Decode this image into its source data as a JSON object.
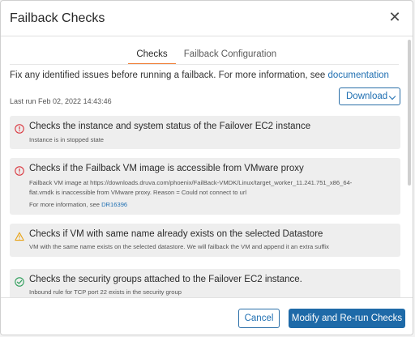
{
  "dialog": {
    "title": "Failback Checks"
  },
  "tabs": [
    {
      "label": "Checks",
      "active": true
    },
    {
      "label": "Failback Configuration",
      "active": false
    }
  ],
  "intro": {
    "text": "Fix any identified issues before running a failback. For more information, see ",
    "link": "documentation"
  },
  "last_run": "Last run Feb 02, 2022 14:43:46",
  "download": {
    "label": "Download"
  },
  "checks": [
    {
      "status": "error",
      "icon": "error-icon",
      "title": "Checks the instance and system status of the Failover EC2 instance",
      "desc": [
        "Instance is in stopped state"
      ]
    },
    {
      "status": "error",
      "icon": "error-icon",
      "title": "Checks if the Failback VM image is accessible from VMware proxy",
      "desc": [
        "Failback VM image at https://downloads.druva.com/phoenix/FailBack-VMDK/Linux/target_worker_11.241.751_x86_64-",
        "flat.vmdk is inaccessible from VMware proxy. Reason = Could not connect to url"
      ],
      "more_prefix": "For more information, see ",
      "more_link": "DR16396"
    },
    {
      "status": "warning",
      "icon": "warning-icon",
      "title": "Checks if VM with same name already exists on the selected Datastore",
      "desc": [
        "VM with the same name exists on the selected datastore. We will failback the VM and append it an extra suffix"
      ]
    },
    {
      "status": "success",
      "icon": "check-circle-icon",
      "title": "Checks the security groups attached to the Failover EC2 instance.",
      "desc": [
        "Inbound rule for TCP port 22 exists in the security group"
      ]
    }
  ],
  "footer": {
    "cancel_label": "Cancel",
    "primary_label": "Modify and Re-run Checks"
  },
  "colors": {
    "accent": "#1e6aa8",
    "tab_underline": "#f0813a",
    "error": "#d9363e",
    "warning": "#e8a317",
    "success": "#2e9e5b"
  }
}
